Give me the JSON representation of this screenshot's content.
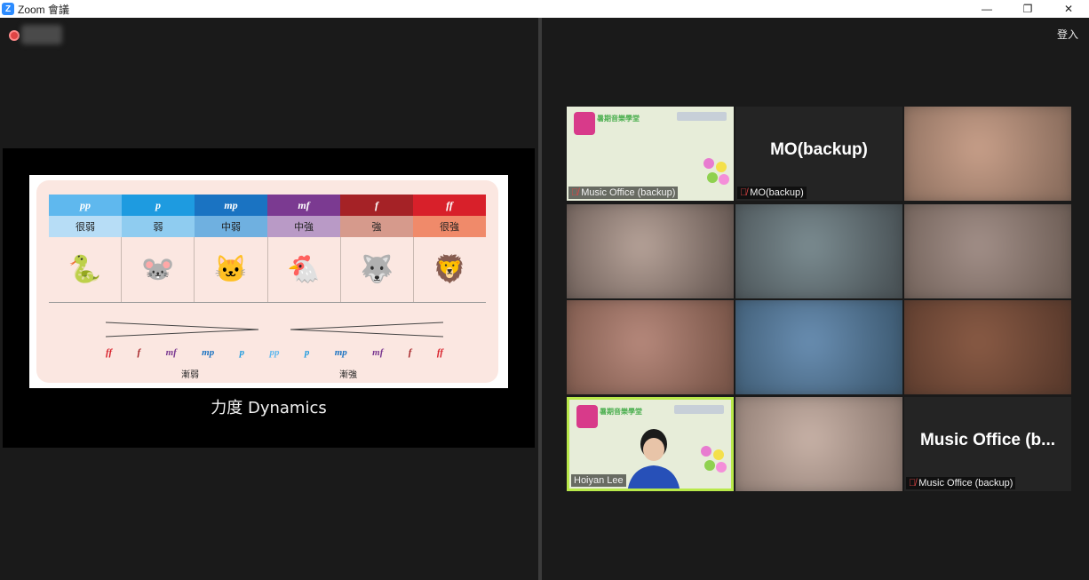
{
  "window": {
    "title": "Zoom 會議",
    "app_icon_letter": "Z",
    "controls": {
      "minimize": "—",
      "restore": "❐",
      "close": "✕"
    }
  },
  "toolbar_right": {
    "signin_label": "登入"
  },
  "share": {
    "caption": "力度 Dynamics",
    "dynamics": [
      {
        "mark": "pp",
        "cn": "很弱",
        "color": "#5fb8ee",
        "cnbg": "#b7ddf6",
        "animal": "🐍"
      },
      {
        "mark": "p",
        "cn": "弱",
        "color": "#1e9be0",
        "cnbg": "#8fccf0",
        "animal": "🐭"
      },
      {
        "mark": "mp",
        "cn": "中弱",
        "color": "#1a73c2",
        "cnbg": "#6fb0e0",
        "animal": "🐱"
      },
      {
        "mark": "mf",
        "cn": "中強",
        "color": "#7b3a91",
        "cnbg": "#b99ac6",
        "animal": "🐔"
      },
      {
        "mark": "f",
        "cn": "強",
        "color": "#a52226",
        "cnbg": "#d69a8c",
        "animal": "🐺"
      },
      {
        "mark": "ff",
        "cn": "很強",
        "color": "#d8202a",
        "cnbg": "#f08a6a",
        "animal": "🦁"
      }
    ],
    "scale_marks": [
      {
        "mark": "ff",
        "color": "#d8202a"
      },
      {
        "mark": "f",
        "color": "#a52226"
      },
      {
        "mark": "mf",
        "color": "#7b3a91"
      },
      {
        "mark": "mp",
        "color": "#1a73c2"
      },
      {
        "mark": "p",
        "color": "#1e9be0"
      },
      {
        "mark": "pp",
        "color": "#5fb8ee"
      },
      {
        "mark": "p",
        "color": "#1e9be0"
      },
      {
        "mark": "mp",
        "color": "#1a73c2"
      },
      {
        "mark": "mf",
        "color": "#7b3a91"
      },
      {
        "mark": "f",
        "color": "#a52226"
      },
      {
        "mark": "ff",
        "color": "#d8202a"
      }
    ],
    "diminuendo_label": "漸弱",
    "crescendo_label": "漸強"
  },
  "gallery": {
    "tiles": [
      {
        "id": "t1",
        "kind": "poster",
        "name": "Music Office (backup)",
        "muted": true
      },
      {
        "id": "t2",
        "kind": "name",
        "name": "MO(backup)",
        "bigname": "MO(backup)",
        "muted": true
      },
      {
        "id": "t3",
        "kind": "blur",
        "colors": [
          "#c9a08a",
          "#8a6d5d"
        ]
      },
      {
        "id": "t4",
        "kind": "blur",
        "colors": [
          "#b8a49a",
          "#6b5c56"
        ]
      },
      {
        "id": "t5",
        "kind": "blur",
        "colors": [
          "#7c8d92",
          "#4a5357"
        ]
      },
      {
        "id": "t6",
        "kind": "blur",
        "colors": [
          "#a39089",
          "#6f5f57"
        ]
      },
      {
        "id": "t7",
        "kind": "blur",
        "colors": [
          "#b88a7d",
          "#7a5649"
        ]
      },
      {
        "id": "t8",
        "kind": "blur",
        "colors": [
          "#6a8fb3",
          "#3d5a72"
        ]
      },
      {
        "id": "t9",
        "kind": "blur",
        "colors": [
          "#8a5b45",
          "#5a3a2c"
        ]
      },
      {
        "id": "t10",
        "kind": "poster-person",
        "name": "Hoiyan Lee",
        "muted": false,
        "active": true
      },
      {
        "id": "t11",
        "kind": "blur",
        "colors": [
          "#c9b3a8",
          "#8d7a71"
        ]
      },
      {
        "id": "t12",
        "kind": "name",
        "name": "Music Office (backup)",
        "bigname": "Music Office  (b...",
        "muted": true
      }
    ],
    "poster_text": "暑期音樂學堂",
    "mute_icon": "mic-off-icon"
  }
}
